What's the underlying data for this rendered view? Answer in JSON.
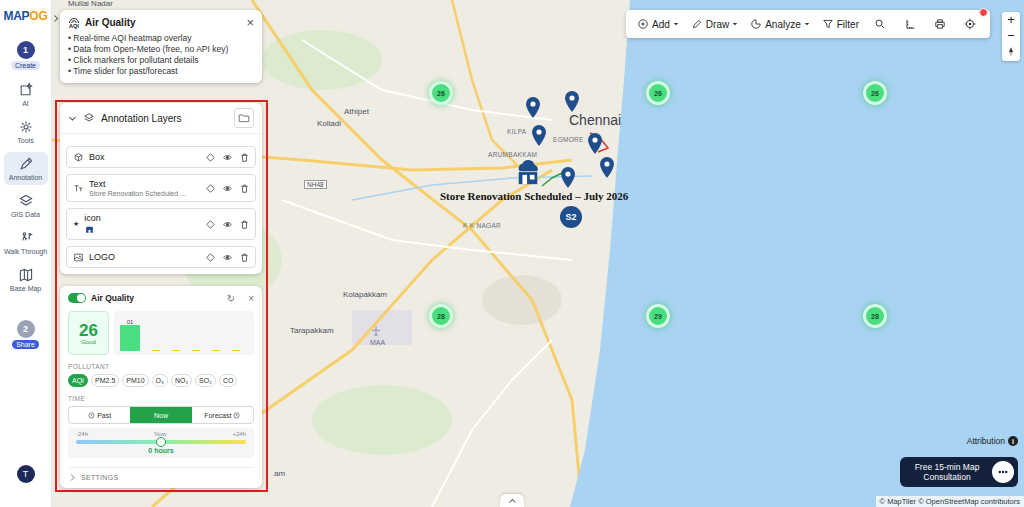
{
  "logo": {
    "primary": "MAP",
    "accent": "OG"
  },
  "sidebar": {
    "items": [
      {
        "kind": "step",
        "number": "1",
        "label": "Create",
        "selected": true
      },
      {
        "kind": "tool",
        "number": "",
        "label": "AI",
        "selected": false
      },
      {
        "kind": "tool",
        "number": "",
        "label": "Tools",
        "selected": false
      },
      {
        "kind": "tool",
        "number": "",
        "label": "Annotation",
        "selected": true
      },
      {
        "kind": "tool",
        "number": "",
        "label": "GIS Data",
        "selected": false
      },
      {
        "kind": "tool",
        "number": "",
        "label": "Walk Through",
        "selected": false
      },
      {
        "kind": "tool",
        "number": "",
        "label": "Base Map",
        "selected": false
      },
      {
        "kind": "step",
        "number": "2",
        "label": "Share",
        "selected": false
      }
    ],
    "user_initial": "T"
  },
  "info_popup": {
    "badge": "AQI",
    "title": "Air Quality",
    "close": "×",
    "lines": [
      "• Real-time AQI heatmap overlay",
      "• Data from Open-Meteo (free, no API key)",
      "• Click markers for pollutant details",
      "• Time slider for past/forecast"
    ]
  },
  "annotation_layers": {
    "title": "Annotation Layers",
    "expanded": true,
    "layers": [
      {
        "kind": "box",
        "marker": "",
        "name": "Box",
        "subtitle": "",
        "visible": true
      },
      {
        "kind": "text",
        "marker": "",
        "name": "Text",
        "subtitle": "Store Renovation Scheduled ...",
        "visible": true
      },
      {
        "kind": "icon",
        "marker": "★",
        "name": "icon",
        "subtitle": "",
        "visible": true
      },
      {
        "kind": "image",
        "marker": "",
        "name": "LOGO",
        "subtitle": "",
        "visible": true
      }
    ]
  },
  "air_quality": {
    "enabled": true,
    "title": "Air Quality",
    "refresh": "↻",
    "close": "×",
    "aqi": {
      "value": "26",
      "label": "Good"
    },
    "chart": {
      "max": 30,
      "bars": [
        {
          "label": "01",
          "value": 26,
          "color": "#4ade80"
        },
        {
          "label": "",
          "value": 1,
          "color": "#facc15"
        },
        {
          "label": "",
          "value": 1,
          "color": "#facc15"
        },
        {
          "label": "",
          "value": 1,
          "color": "#facc15"
        },
        {
          "label": "",
          "value": 1,
          "color": "#facc15"
        },
        {
          "label": "",
          "value": 1,
          "color": "#facc15"
        }
      ]
    },
    "pollutant": {
      "label": "POLLUTANT",
      "options": [
        {
          "label": "AQI",
          "selected": true
        },
        {
          "label": "PM2.5",
          "selected": false
        },
        {
          "label": "PM10",
          "selected": false
        },
        {
          "label": "O₃",
          "selected": false
        },
        {
          "label": "NO₂",
          "selected": false
        },
        {
          "label": "SO₂",
          "selected": false
        },
        {
          "label": "CO",
          "selected": false
        }
      ]
    },
    "time": {
      "label": "TIME",
      "options": [
        {
          "kind": "past",
          "label": "Past",
          "selected": false
        },
        {
          "kind": "now",
          "label": "Now",
          "selected": true
        },
        {
          "kind": "forecast",
          "label": "Forecast",
          "selected": false
        }
      ]
    },
    "slider": {
      "min": "-24h",
      "mid": "Now",
      "max": "+24h",
      "level": 0.5,
      "reading": "0 hours"
    },
    "settings": {
      "label": "SETTINGS",
      "expanded": false
    }
  },
  "toolbar": {
    "menus": [
      {
        "label": "Add",
        "dropdown": true
      },
      {
        "label": "Draw",
        "dropdown": true
      },
      {
        "label": "Analyze",
        "dropdown": true
      },
      {
        "label": "Filter",
        "dropdown": false
      }
    ],
    "notification": true
  },
  "zoom": {
    "zoom_in": "+",
    "zoom_out": "−"
  },
  "map": {
    "labels": [
      {
        "text": "Mullai Nadar",
        "kind": "place"
      },
      {
        "text": "Athipet",
        "kind": "place"
      },
      {
        "text": "Kolladi",
        "kind": "place"
      },
      {
        "text": "Chennai",
        "kind": "city"
      },
      {
        "text": "KILPA",
        "kind": "area"
      },
      {
        "text": "EGMORE",
        "kind": "area"
      },
      {
        "text": "ARUMBAKKAM",
        "kind": "area"
      },
      {
        "text": "NH48",
        "kind": "road"
      },
      {
        "text": "K K NAGAR",
        "kind": "area"
      },
      {
        "text": "Kolapakkam",
        "kind": "place"
      },
      {
        "text": "Tarapakkam",
        "kind": "place"
      },
      {
        "text": "MAA",
        "kind": "airport"
      },
      {
        "text": "am",
        "kind": "place"
      }
    ],
    "aqi_markers": [
      {
        "value": "26"
      },
      {
        "value": "26"
      },
      {
        "value": "26"
      },
      {
        "value": "28"
      },
      {
        "value": "29"
      },
      {
        "value": "28"
      }
    ],
    "pins": [
      {
        "kind": "marker"
      },
      {
        "kind": "marker"
      },
      {
        "kind": "marker"
      },
      {
        "kind": "marker"
      },
      {
        "kind": "marker"
      },
      {
        "kind": "marker"
      }
    ],
    "annotation_text": "Store Renovation Scheduled – July 2026",
    "store_code": "S2"
  },
  "footer": {
    "attribution": "Attribution",
    "info": "i",
    "consultation": "Free 15-min Map Consultation",
    "credits": "© MapTiler © OpenStreetMap contributors"
  }
}
